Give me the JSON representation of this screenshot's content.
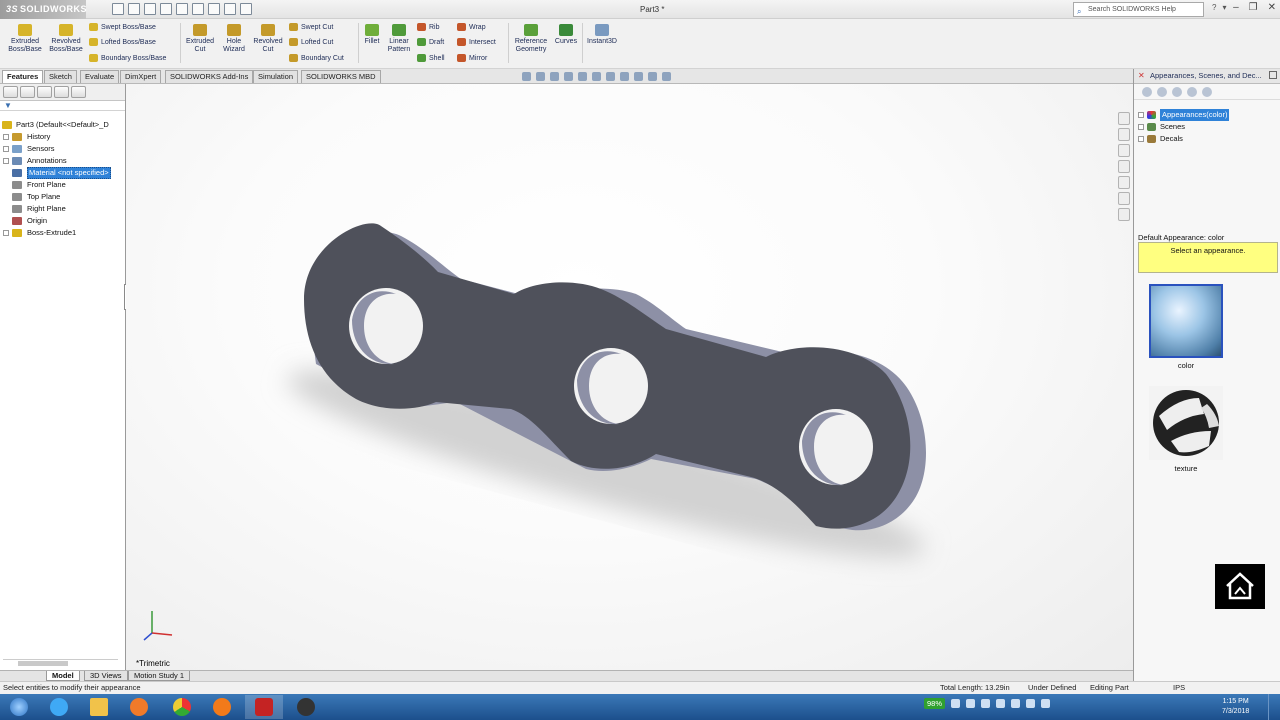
{
  "app": {
    "logo": "SOLIDWORKS",
    "logo_prefix": "3S",
    "window_title": "Part3 *"
  },
  "search": {
    "placeholder": "Search SOLIDWORKS Help"
  },
  "ribbon": {
    "extruded_boss": [
      "Extruded",
      "Boss/Base"
    ],
    "revolved_boss": [
      "Revolved",
      "Boss/Base"
    ],
    "swept_boss": "Swept Boss/Base",
    "lofted_boss": "Lofted Boss/Base",
    "boundary_boss": "Boundary Boss/Base",
    "extruded_cut": [
      "Extruded",
      "Cut"
    ],
    "hole_wizard": [
      "Hole",
      "Wizard"
    ],
    "revolved_cut": [
      "Revolved",
      "Cut"
    ],
    "swept_cut": "Swept Cut",
    "lofted_cut": "Lofted Cut",
    "boundary_cut": "Boundary Cut",
    "fillet": "Fillet",
    "linear_pattern": [
      "Linear",
      "Pattern"
    ],
    "rib": "Rib",
    "draft": "Draft",
    "shell": "Shell",
    "wrap": "Wrap",
    "intersect": "Intersect",
    "mirror": "Mirror",
    "reference_geometry": [
      "Reference",
      "Geometry"
    ],
    "curves": "Curves",
    "instant3d": "Instant3D"
  },
  "tabs": [
    "Features",
    "Sketch",
    "Evaluate",
    "DimXpert",
    "SOLIDWORKS Add-Ins",
    "Simulation",
    "SOLIDWORKS MBD"
  ],
  "tree": {
    "root": "Part3  (Default<<Default>_D",
    "items": [
      {
        "label": "History",
        "icon_color": "#c69a2e"
      },
      {
        "label": "Sensors",
        "icon_color": "#7aa0c9"
      },
      {
        "label": "Annotations",
        "icon_color": "#6b8bb5"
      },
      {
        "label": "Material <not specified>",
        "icon_color": "#4a6fa5"
      },
      {
        "label": "Front Plane",
        "icon_color": "#8c8c8c"
      },
      {
        "label": "Top Plane",
        "icon_color": "#8c8c8c"
      },
      {
        "label": "Right Plane",
        "icon_color": "#8c8c8c"
      },
      {
        "label": "Origin",
        "icon_color": "#b05050"
      },
      {
        "label": "Boss-Extrude1",
        "icon_color": "#d9b41a"
      }
    ]
  },
  "viewport": {
    "view_name": "*Trimetric",
    "part_color": "#4f515b",
    "edge_color": "#8d90a6"
  },
  "task_pane": {
    "title": "Appearances, Scenes, and Dec...",
    "tree": [
      "Appearances(color)",
      "Scenes",
      "Decals"
    ],
    "default_appearance": "Default Appearance: color",
    "hint": "Select an appearance.",
    "tiles": [
      "color",
      "texture"
    ]
  },
  "bottom_tabs": [
    "Model",
    "3D Views",
    "Motion Study 1"
  ],
  "status": {
    "message": "Select entities to modify their appearance",
    "total_length": "Total Length: 13.29in",
    "definition": "Under Defined",
    "mode": "Editing Part",
    "units": "IPS"
  },
  "taskbar": {
    "battery": "98%",
    "time": "1:15 PM",
    "date": "7/3/2018"
  },
  "colors": {
    "accent": "#2f82d8",
    "hint_bg": "#ffff80",
    "taskbar": "#2a64a3"
  }
}
